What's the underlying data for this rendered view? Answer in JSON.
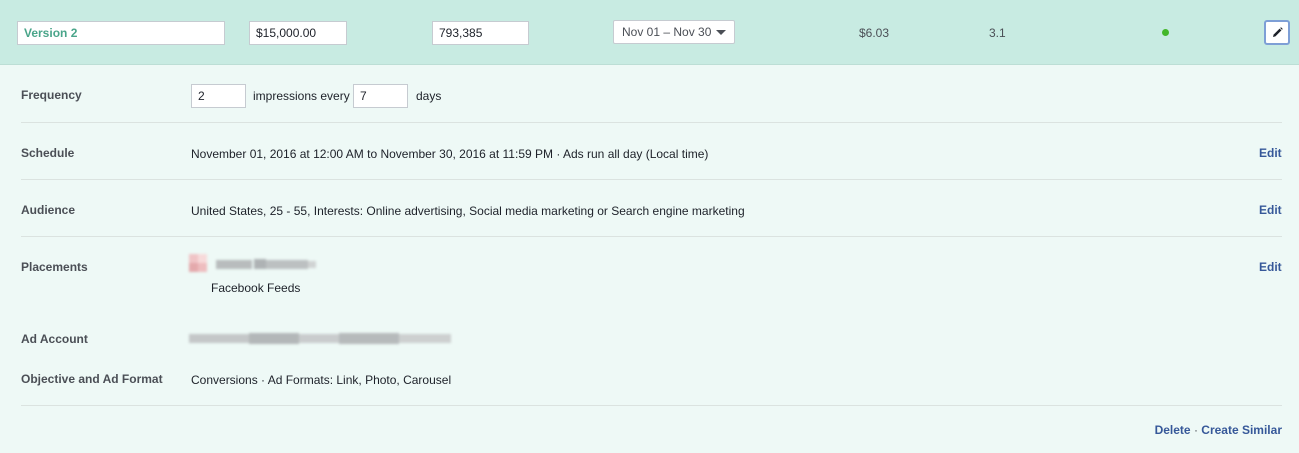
{
  "row": {
    "name": "Version 2",
    "budget": "$15,000.00",
    "reach": "793,385",
    "date_range": "Nov 01 – Nov 30",
    "cost": "$6.03",
    "frequency_metric": "3.1",
    "status_color": "#42b72a"
  },
  "frequency": {
    "label": "Frequency",
    "impressions_value": "2",
    "middle_text": "impressions every",
    "days_value": "7",
    "days_text": "days"
  },
  "schedule": {
    "label": "Schedule",
    "value": "November 01, 2016 at 12:00 AM to November 30, 2016 at 11:59 PM · Ads run all day (Local time)",
    "edit": "Edit"
  },
  "audience": {
    "label": "Audience",
    "value": "United States, 25 - 55, Interests: Online advertising, Social media marketing or Search engine marketing",
    "edit": "Edit"
  },
  "placements": {
    "label": "Placements",
    "value": "Facebook Feeds",
    "edit": "Edit"
  },
  "ad_account": {
    "label": "Ad Account"
  },
  "objective": {
    "label": "Objective and Ad Format",
    "value": "Conversions · Ad Formats: Link, Photo, Carousel"
  },
  "footer": {
    "delete": "Delete",
    "separator": "·",
    "create_similar": "Create Similar"
  },
  "icons": {
    "edit": "pencil-icon",
    "dropdown": "caret-down-icon"
  },
  "colors": {
    "header_bg": "#c8ebe2",
    "panel_bg": "#eef9f6",
    "link": "#365899",
    "name_text": "#4aa58a"
  }
}
